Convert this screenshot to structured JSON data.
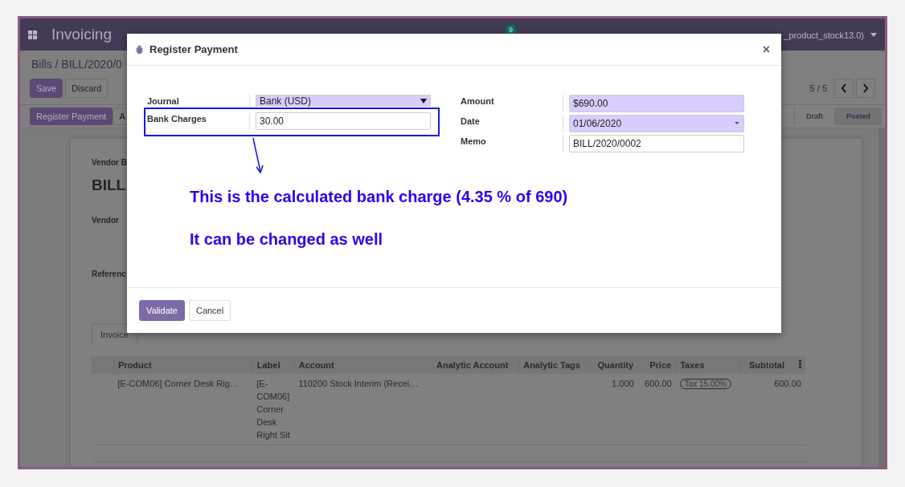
{
  "navbar": {
    "app_title": "Invoicing",
    "message_count": "9",
    "user": "_product_stock13.0)"
  },
  "breadcrumb": "Bills / BILL/2020/0",
  "edit_buttons": [
    {
      "label": "Save",
      "kind": "primary"
    },
    {
      "label": "Discard",
      "kind": "secondary"
    }
  ],
  "pager": "5 / 5",
  "actions": [
    {
      "label": "Register Payment",
      "kind": "primary"
    },
    {
      "label": "A",
      "kind": "secondary"
    }
  ],
  "status_steps": [
    {
      "label": "Draft",
      "selected": false
    },
    {
      "label": "Posted",
      "selected": true
    }
  ],
  "sheet": {
    "doc_type": "Vendor B",
    "title": "BILL",
    "fields": [
      "Vendor",
      "Referenc"
    ],
    "tab": "Invoice"
  },
  "table": {
    "columns": [
      {
        "label": "Product",
        "kind": "text"
      },
      {
        "label": "Label",
        "kind": "text"
      },
      {
        "label": "Account",
        "kind": "text"
      },
      {
        "label": "Analytic Account",
        "kind": "text"
      },
      {
        "label": "Analytic Tags",
        "kind": "text"
      },
      {
        "label": "Quantity",
        "kind": "number"
      },
      {
        "label": "Price",
        "kind": "number"
      },
      {
        "label": "Taxes",
        "kind": "text"
      },
      {
        "label": "Subtotal",
        "kind": "number"
      }
    ],
    "rows": [
      {
        "product": "[E-COM06] Corner Desk Rig…",
        "label": "[E-COM06] Corner Desk Right Sit",
        "account": "110200 Stock Interim (Recei…",
        "quantity": "1.000",
        "price": "600.00",
        "tax": "Tax 15.00%",
        "subtotal": "600.00"
      }
    ]
  },
  "dialog": {
    "title": "Register Payment",
    "close_label": "×",
    "left_fields": [
      {
        "label": "Journal",
        "value": "Bank (USD)",
        "kind": "select",
        "required": true,
        "highlighted": false
      },
      {
        "label": "Bank Charges",
        "value": "30.00",
        "kind": "input",
        "required": false,
        "highlighted": true
      }
    ],
    "right_fields": [
      {
        "label": "Amount",
        "value": "$690.00",
        "kind": "input",
        "required": true
      },
      {
        "label": "Date",
        "value": "01/06/2020",
        "kind": "date",
        "required": true
      },
      {
        "label": "Memo",
        "value": "BILL/2020/0002",
        "kind": "input",
        "required": false
      }
    ],
    "notes": [
      "This is the calculated bank charge (4.35 % of 690)",
      "It can be changed as well"
    ],
    "buttons": [
      {
        "label": "Validate",
        "kind": "primary"
      },
      {
        "label": "Cancel",
        "kind": "secondary"
      }
    ]
  }
}
